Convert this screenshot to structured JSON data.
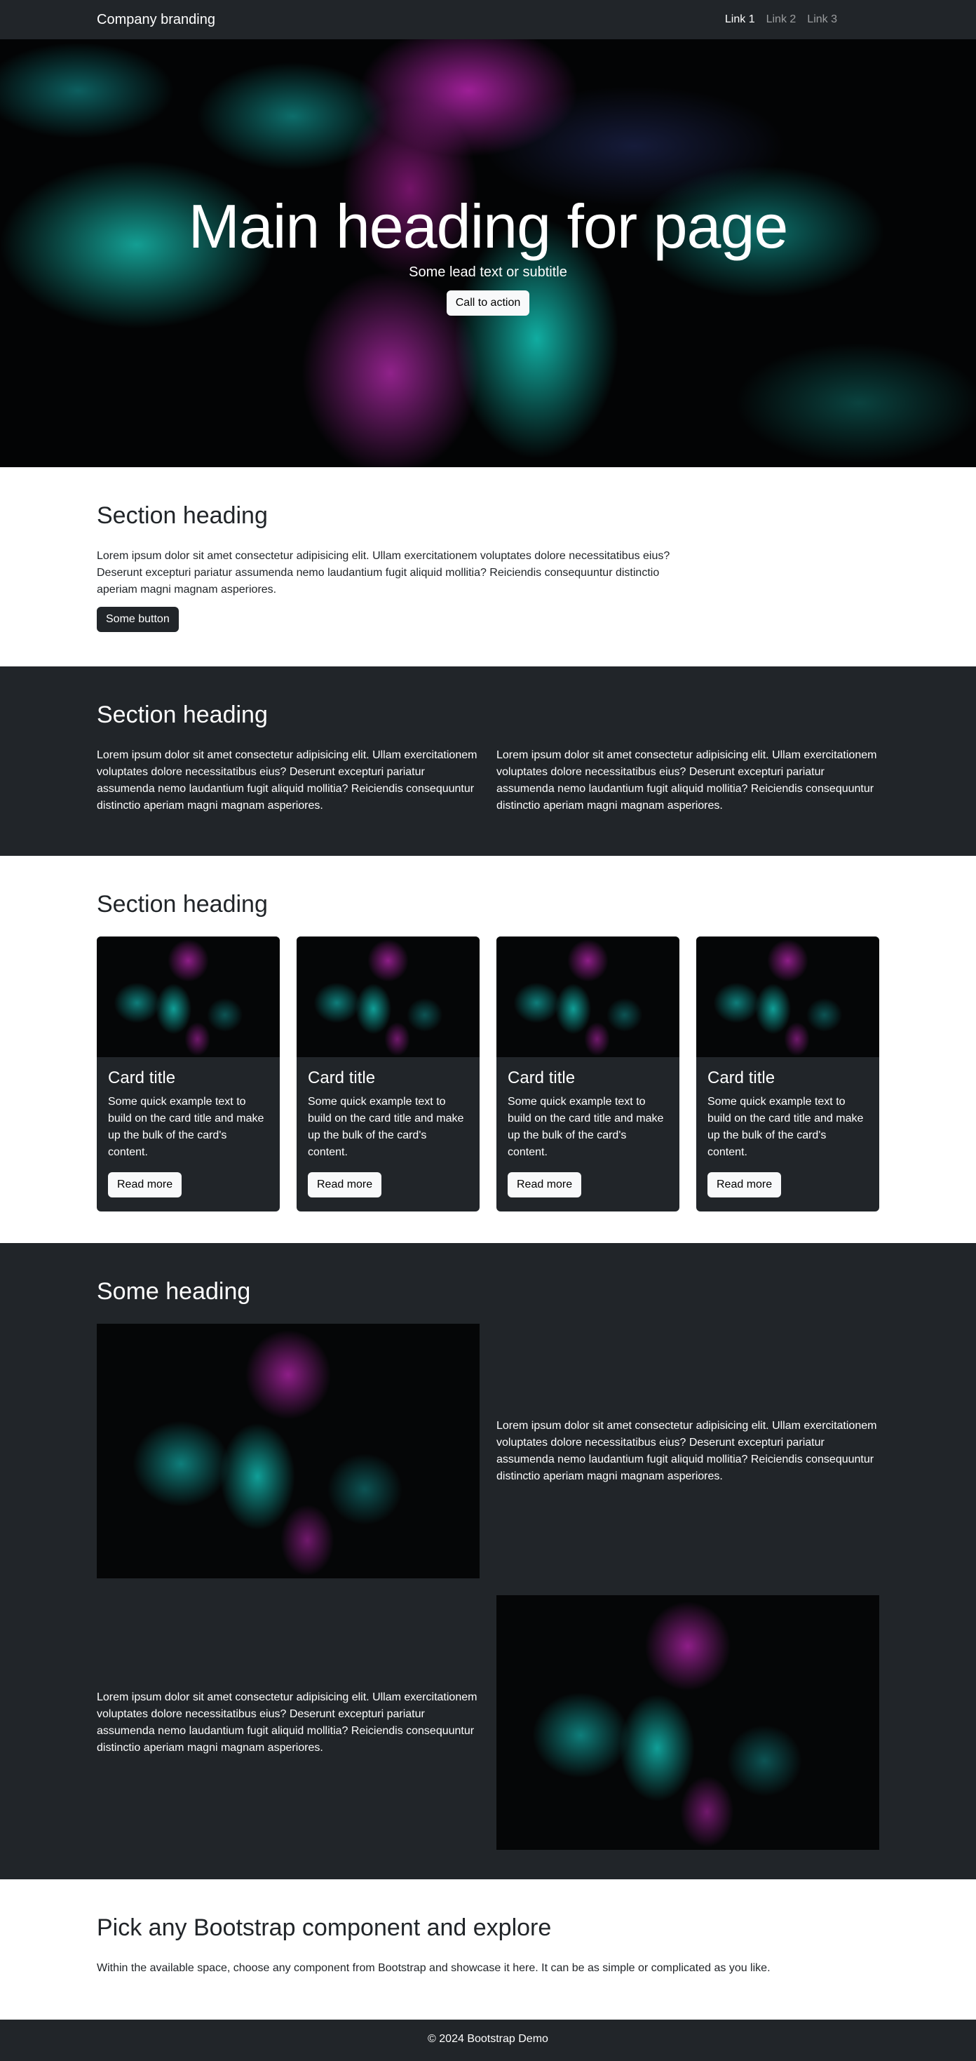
{
  "navbar": {
    "brand": "Company branding",
    "links": [
      {
        "label": "Link 1",
        "active": true
      },
      {
        "label": "Link 2",
        "active": false
      },
      {
        "label": "Link 3",
        "active": false
      }
    ]
  },
  "hero": {
    "title": "Main heading for page",
    "lead": "Some lead text or subtitle",
    "cta": "Call to action"
  },
  "section1": {
    "heading": "Section heading",
    "text": "Lorem ipsum dolor sit amet consectetur adipisicing elit. Ullam exercitationem voluptates dolore necessitatibus eius? Deserunt excepturi pariatur assumenda nemo laudantium fugit aliquid mollitia? Reiciendis consequuntur distinctio aperiam magni magnam asperiores.",
    "button": "Some button"
  },
  "section2": {
    "heading": "Section heading",
    "col1": "Lorem ipsum dolor sit amet consectetur adipisicing elit. Ullam exercitationem voluptates dolore necessitatibus eius? Deserunt excepturi pariatur assumenda nemo laudantium fugit aliquid mollitia? Reiciendis consequuntur distinctio aperiam magni magnam asperiores.",
    "col2": "Lorem ipsum dolor sit amet consectetur adipisicing elit. Ullam exercitationem voluptates dolore necessitatibus eius? Deserunt excepturi pariatur assumenda nemo laudantium fugit aliquid mollitia? Reiciendis consequuntur distinctio aperiam magni magnam asperiores."
  },
  "section3": {
    "heading": "Section heading",
    "cards": [
      {
        "title": "Card title",
        "text": "Some quick example text to build on the card title and make up the bulk of the card's content.",
        "button": "Read more"
      },
      {
        "title": "Card title",
        "text": "Some quick example text to build on the card title and make up the bulk of the card's content.",
        "button": "Read more"
      },
      {
        "title": "Card title",
        "text": "Some quick example text to build on the card title and make up the bulk of the card's content.",
        "button": "Read more"
      },
      {
        "title": "Card title",
        "text": "Some quick example text to build on the card title and make up the bulk of the card's content.",
        "button": "Read more"
      }
    ]
  },
  "section4": {
    "heading": "Some heading",
    "row1_text": "Lorem ipsum dolor sit amet consectetur adipisicing elit. Ullam exercitationem voluptates dolore necessitatibus eius? Deserunt excepturi pariatur assumenda nemo laudantium fugit aliquid mollitia? Reiciendis consequuntur distinctio aperiam magni magnam asperiores.",
    "row2_text": "Lorem ipsum dolor sit amet consectetur adipisicing elit. Ullam exercitationem voluptates dolore necessitatibus eius? Deserunt excepturi pariatur assumenda nemo laudantium fugit aliquid mollitia? Reiciendis consequuntur distinctio aperiam magni magnam asperiores."
  },
  "section5": {
    "heading": "Pick any Bootstrap component and explore",
    "text": "Within the available space, choose any component from Bootstrap and showcase it here. It can be as simple or complicated as you like."
  },
  "footer": {
    "text": "© 2024 Bootstrap Demo"
  },
  "colors": {
    "dark": "#212529",
    "light": "#f8f9fa",
    "accent_teal": "#14d7c8",
    "accent_magenta": "#d228c8"
  }
}
